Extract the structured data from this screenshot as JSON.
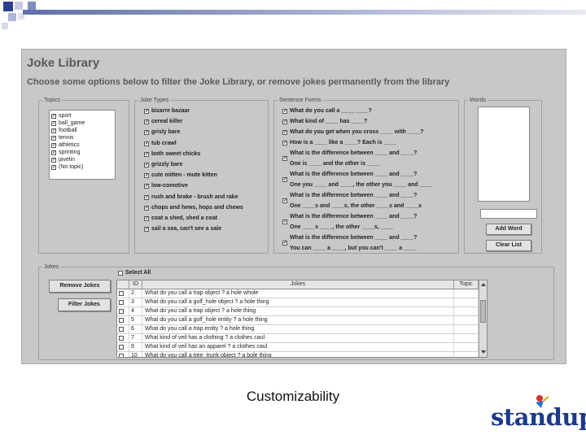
{
  "app": {
    "title": "Joke Library",
    "subtitle": "Choose some options below to filter the Joke Library, or remove jokes permanently from the library"
  },
  "topics": {
    "legend": "Topics",
    "items": [
      {
        "label": "sport",
        "checked": true
      },
      {
        "label": "ball_game",
        "checked": true
      },
      {
        "label": "football",
        "checked": true
      },
      {
        "label": "tennis",
        "checked": true
      },
      {
        "label": "athletics",
        "checked": true
      },
      {
        "label": "sprinting",
        "checked": true
      },
      {
        "label": "javelin",
        "checked": true
      },
      {
        "label": "(No topic)",
        "checked": true
      }
    ]
  },
  "joke_types": {
    "legend": "Joke Types",
    "items": [
      {
        "label": "bizarre bazaar",
        "checked": true
      },
      {
        "label": "cereal killer",
        "checked": true
      },
      {
        "label": "grisly bare",
        "checked": true
      },
      {
        "label": "tub crawl",
        "checked": true
      },
      {
        "label": "both sweet chicks",
        "checked": true
      },
      {
        "label": "grizzly bare",
        "checked": true
      },
      {
        "label": "cute mitten - mute kitten",
        "checked": true
      },
      {
        "label": "low-comotive",
        "checked": true
      },
      {
        "label": "rush and brake - brush and rake",
        "checked": true
      },
      {
        "label": "chops and hews, hops and chews",
        "checked": true
      },
      {
        "label": "coat a shed, shed a coat",
        "checked": true
      },
      {
        "label": "sail a sea, can't see a sale",
        "checked": true
      }
    ]
  },
  "sentence_forms": {
    "legend": "Sentence Forms",
    "items": [
      {
        "line1": "What do you call a ____ ____?",
        "line2": "",
        "checked": true
      },
      {
        "line1": "What kind of ____ has ____?",
        "line2": "",
        "checked": true
      },
      {
        "line1": "What do you get when you cross ____ with ____?",
        "line2": "",
        "checked": true
      },
      {
        "line1": "How is a ____ like a ____? Each is ____",
        "line2": "",
        "checked": true
      },
      {
        "line1": "What is the difference between ____ and ____?",
        "line2": "One is ____ and the other is ____",
        "checked": true
      },
      {
        "line1": "What is the difference between ____ and ____?",
        "line2": "One you ____ and ____, the other you ____ and ____",
        "checked": true
      },
      {
        "line1": "What is the difference between ____ and ____?",
        "line2": "One ____s and ____s, the other ____s and ____s",
        "checked": true
      },
      {
        "line1": "What is the difference between ____ and ____?",
        "line2": "One ____s ____, the other ____s, ____",
        "checked": true
      },
      {
        "line1": "What is the difference between ____ and ____?",
        "line2": "You can ____ a ____, but you can't ____ a ____",
        "checked": true
      }
    ]
  },
  "words": {
    "legend": "Words",
    "add_label": "Add Word",
    "clear_label": "Clear List"
  },
  "jokes": {
    "legend": "Jokes",
    "select_all_label": "Select All",
    "remove_label": "Remove Jokes",
    "filter_label": "Filter Jokes",
    "columns": [
      "ID",
      "Jokes",
      "Topic"
    ],
    "rows": [
      {
        "id": "2",
        "joke": "What do you call a trap object ? a hole whole",
        "topic": ""
      },
      {
        "id": "3",
        "joke": "What do you call a golf_hole object ? a hole thing",
        "topic": ""
      },
      {
        "id": "4",
        "joke": "What do you call a trap object ? a hole thing",
        "topic": ""
      },
      {
        "id": "5",
        "joke": "What do you call a golf_hole entity ? a hole thing",
        "topic": ""
      },
      {
        "id": "6",
        "joke": "What do you call a trap entity ? a hole thing",
        "topic": ""
      },
      {
        "id": "7",
        "joke": "What kind of veil has a clothing ? a clothes caul",
        "topic": ""
      },
      {
        "id": "9",
        "joke": "What kind of veil has an apparel ? a clothes caul",
        "topic": ""
      },
      {
        "id": "10",
        "joke": "What do you call a tree_trunk object ? a bole thing",
        "topic": ""
      }
    ]
  },
  "slide": {
    "caption": "Customizability",
    "logo_text": "standup"
  },
  "colors": {
    "panel": "#c8c8c8",
    "logo": "#1b3a8a",
    "accent_bar": "#5f6fa8"
  }
}
